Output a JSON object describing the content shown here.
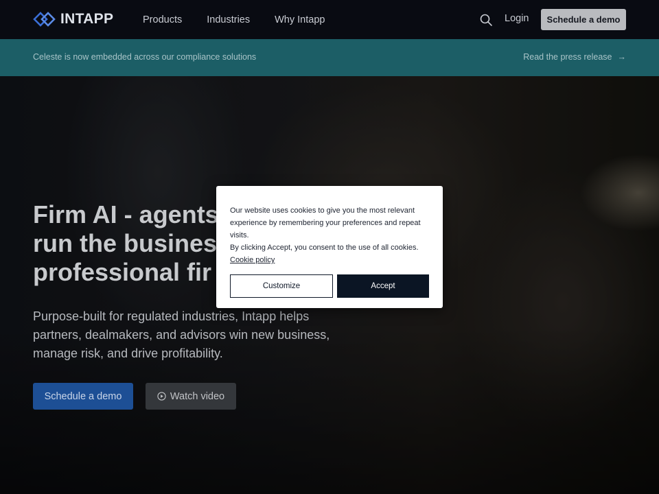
{
  "brand": {
    "name": "INTAPP",
    "accent": "#3a6fd8"
  },
  "nav": {
    "items": [
      {
        "label": "Products"
      },
      {
        "label": "Industries"
      },
      {
        "label": "Why Intapp"
      }
    ],
    "search_icon": "search-icon",
    "login_label": "Login",
    "cta_label": "Schedule a demo"
  },
  "announcement": {
    "text": "Celeste is now embedded across our compliance solutions",
    "link_label": "Read the press release",
    "link_arrow": "→",
    "color": "#1c5e66"
  },
  "hero": {
    "title_lines": [
      "Firm AI - agents",
      "run the business",
      "professional fir"
    ],
    "subtitle": "Purpose-built for regulated industries, Intapp helps partners, dealmakers, and advisors win new business, manage risk, and drive profitability.",
    "primary_button": "Schedule a demo",
    "secondary_button": "Watch video",
    "primary_color": "#1d4f95"
  },
  "cookie_banner": {
    "text_1": "Our website uses cookies to give you the most relevant experience by remembering your preferences and repeat visits.",
    "text_2": "By clicking Accept, you consent to the use of all cookies.",
    "policy_link": "Cookie policy",
    "customize_label": "Customize",
    "accept_label": "Accept"
  }
}
